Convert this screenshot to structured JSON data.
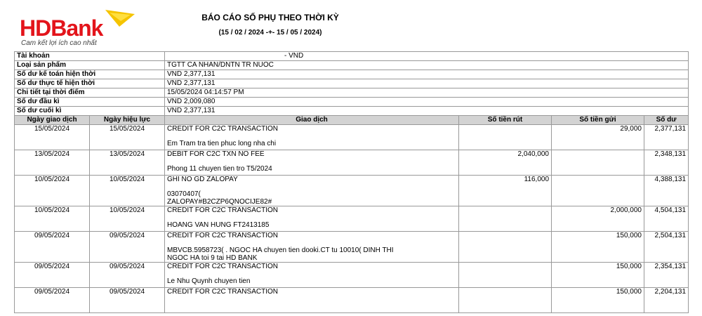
{
  "brand": {
    "name_hd": "HD",
    "name_bank": "Bank",
    "tagline": "Cam kết lợi ích cao nhất"
  },
  "report": {
    "title": "BÁO CÁO SỐ PHỤ THEO THỜI KỲ",
    "period": "(15 / 02 / 2024  -+-   15 / 05 / 2024)"
  },
  "account_info": [
    {
      "label": "Tài khoản",
      "value": "- VND"
    },
    {
      "label": "Loại sản phẩm",
      "value": "TGTT CA NHAN/DNTN TR NUOC"
    },
    {
      "label": "Số dư kế toán hiện thời",
      "value": "VND 2,377,131"
    },
    {
      "label": "Số dư thực tế hiện thời",
      "value": "VND 2,377,131"
    },
    {
      "label": "Chi tiết tại thời điểm",
      "value": "15/05/2024 04:14:57 PM"
    },
    {
      "label": "Số dư đầu kì",
      "value": "VND 2,009,080"
    },
    {
      "label": "Số dư cuối kì",
      "value": "VND 2,377,131"
    }
  ],
  "columns": [
    "Ngày giao dịch",
    "Ngày hiệu lực",
    "Giao dịch",
    "Số tiền rút",
    "Số tiền gửi",
    "Số dư"
  ],
  "transactions": [
    {
      "date": "15/05/2024",
      "value_date": "15/05/2024",
      "type": "CREDIT FOR C2C TRANSACTION",
      "detail1": "Em Tram tra tien phuc long nha chi",
      "detail2": "",
      "withdraw": "",
      "deposit": "29,000",
      "balance": "2,377,131"
    },
    {
      "date": "13/05/2024",
      "value_date": "13/05/2024",
      "type": "DEBIT FOR C2C TXN NO FEE",
      "detail1": "Phong 11 chuyen tien tro T5/2024",
      "detail2": "",
      "withdraw": "2,040,000",
      "deposit": "",
      "balance": "2,348,131"
    },
    {
      "date": "10/05/2024",
      "value_date": "10/05/2024",
      "type": "GHI NO GD ZALOPAY",
      "detail1": "03070407(",
      "detail2": "ZALOPAY#B2CZP6QNOCIJE82#",
      "withdraw": "116,000",
      "deposit": "",
      "balance": "4,388,131"
    },
    {
      "date": "10/05/2024",
      "value_date": "10/05/2024",
      "type": "CREDIT FOR C2C TRANSACTION",
      "detail1": "HOANG VAN HUNG FT2413185",
      "detail2": "",
      "withdraw": "",
      "deposit": "2,000,000",
      "balance": "4,504,131"
    },
    {
      "date": "09/05/2024",
      "value_date": "09/05/2024",
      "type": "CREDIT FOR C2C TRANSACTION",
      "detail1": "MBVCB.5958723(                    . NGOC HA chuyen tien dooki.CT tu 10010(                 DINH THI",
      "detail2": "NGOC HA toi 9                                                                tai HD BANK",
      "withdraw": "",
      "deposit": "150,000",
      "balance": "2,504,131"
    },
    {
      "date": "09/05/2024",
      "value_date": "09/05/2024",
      "type": "CREDIT FOR C2C TRANSACTION",
      "detail1": "Le Nhu Quynh chuyen tien",
      "detail2": "",
      "withdraw": "",
      "deposit": "150,000",
      "balance": "2,354,131"
    },
    {
      "date": "09/05/2024",
      "value_date": "09/05/2024",
      "type": "CREDIT FOR C2C TRANSACTION",
      "detail1": "",
      "detail2": "",
      "withdraw": "",
      "deposit": "150,000",
      "balance": "2,204,131"
    }
  ],
  "colors": {
    "brand_red": "#e3141b",
    "brand_yellow": "#f5c400",
    "header_bg": "#d3d3d3"
  }
}
